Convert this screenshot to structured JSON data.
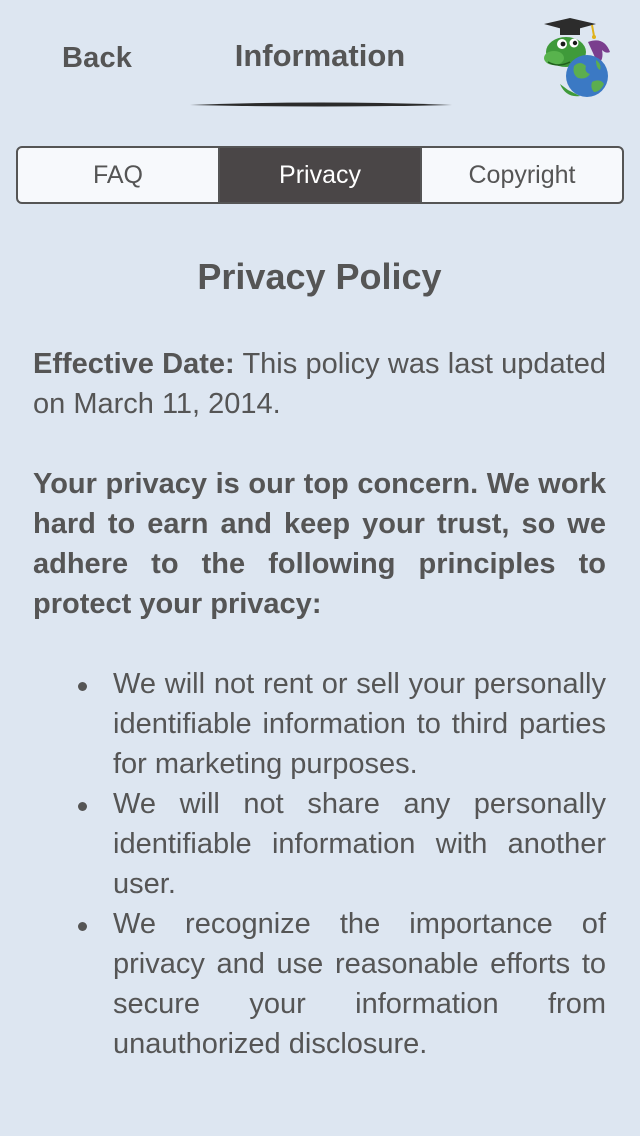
{
  "nav": {
    "back_label": "Back",
    "title": "Information",
    "logo_icon": "dragon-graduate-globe-logo"
  },
  "tabs": [
    {
      "label": "FAQ",
      "selected": false
    },
    {
      "label": "Privacy",
      "selected": true
    },
    {
      "label": "Copyright",
      "selected": false
    }
  ],
  "content": {
    "heading": "Privacy Policy",
    "effective_date_label": "Effective Date:",
    "effective_date_text": " This policy was last updated on March 11, 2014.",
    "intro": "Your privacy is our top concern. We work hard to earn and keep your trust, so we adhere to the following principles to protect your privacy:",
    "principles": [
      "We will not rent or sell your personally identifiable information to third parties for marketing purposes.",
      "We will not share any personally identifiable information with another user.",
      "We recognize the importance of privacy and use reasonable efforts to secure your information from unauthorized disclosure."
    ]
  },
  "colors": {
    "background": "#dde6f1",
    "text": "#555555",
    "selected_tab": "#4a4647"
  }
}
